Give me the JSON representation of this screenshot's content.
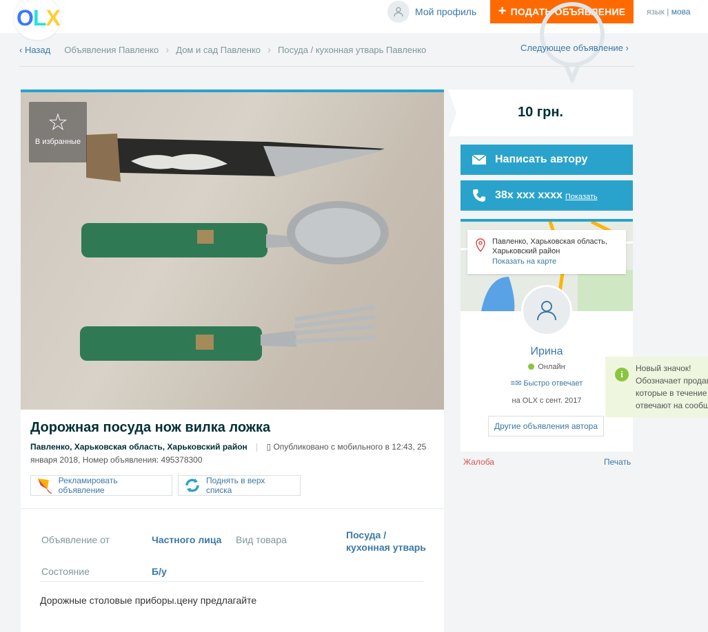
{
  "header": {
    "profile_label": "Мой профиль",
    "post_button": "ПОДАТЬ ОБЪЯВЛЕНИЕ",
    "lang_label": "язык",
    "lang_divider": "|",
    "lang_active": "мова"
  },
  "breadcrumb": {
    "back": "Назад",
    "items": [
      "Объявления Павленко",
      "Дом и сад Павленко",
      "Посуда / кухонная утварь Павленко"
    ],
    "next": "Следующее объявление"
  },
  "ad": {
    "favorite_label": "В избранные",
    "title": "Дорожная посуда нож вилка ложка",
    "location": "Павленко, Харьковская область, Харьковский район",
    "published_mobile": "Опубликовано с мобильного",
    "published_at": "в 12:43, 25 января 2018, Номер объявления: 495378300",
    "promote_label": "Рекламировать объявление",
    "raise_label": "Поднять в верх списка",
    "params": [
      {
        "label": "Объявление от",
        "value": "Частного лица"
      },
      {
        "label": "Вид товара",
        "value": "Посуда / кухонная утварь"
      },
      {
        "label": "Состояние",
        "value": "Б/у"
      }
    ],
    "description": "Дорожные столовые приборы.цену предлагайте"
  },
  "sidebar": {
    "price": "10 грн.",
    "write_author": "Написать автору",
    "phone": "38x xxx xxxx",
    "phone_show": "Показать",
    "map_address": "Павленко, Харьковская область, Харьковский район",
    "map_link": "Показать на карте",
    "seller_name": "Ирина",
    "seller_status": "Онлайн",
    "seller_fast": "Быстро отвечает",
    "seller_since": "на OLX с сент. 2017",
    "other_ads": "Другие объявления автора",
    "complaint": "Жалоба",
    "print": "Печать"
  },
  "badge_tip": {
    "line1": "Новый значок!",
    "line2": "Обозначает продавцов,",
    "line3": "которые в течение",
    "line4": "отвечают на сообщения"
  },
  "colors": {
    "accent": "#2aa3cc",
    "post_button": "#ff6a00",
    "link": "#3b78a6",
    "online": "#8ac53e"
  }
}
